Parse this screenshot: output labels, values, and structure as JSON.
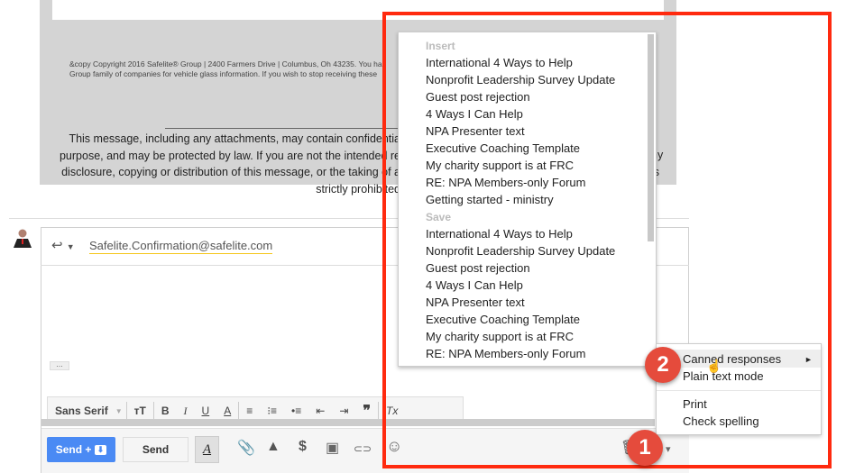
{
  "message": {
    "copyright_lines": [
      "&copy Copyright 2016 Safelite® Group | 2400 Farmers Drive | Columbus, Oh 43235. You ha",
      "Group family of companies for vehicle glass information. If you wish to stop receiving these"
    ],
    "disclaimer_lines": [
      "This message, including any attachments, may contain confidentia",
      "purpose, and may be protected by law. If you are not the intended re",
      "disclosure, copying or distribution of this message, or the taking of a",
      "strictly prohibited"
    ],
    "disclaimer_right": [
      "ny",
      "is"
    ]
  },
  "compose": {
    "to": "Safelite.Confirmation@safelite.com",
    "reply_icon": "reply-icon",
    "font": "Sans Serif",
    "send_plus": "Send +",
    "send": "Send",
    "toolbar_glyphs": {
      "size": "тT",
      "bold": "B",
      "italic": "I",
      "underline": "U",
      "color": "A",
      "quote": "❞",
      "clear": "Tx"
    },
    "bottom_glyphs": {
      "format": "A",
      "attach": "📎",
      "drive": "▲",
      "money": "$",
      "photo": "▣",
      "link": "⊂⊃",
      "emoji": "☺",
      "trash": "🗑",
      "more": "▾"
    }
  },
  "canned": {
    "insert_header": "Insert",
    "insert_items": [
      "International 4 Ways to Help",
      "Nonprofit Leadership Survey Update",
      "Guest post rejection",
      "4 Ways I Can Help",
      "NPA Presenter text",
      "Executive Coaching Template",
      "My charity support is at FRC",
      "RE: NPA Members-only Forum",
      "Getting started - ministry"
    ],
    "save_header": "Save",
    "save_items": [
      "International 4 Ways to Help",
      "Nonprofit Leadership Survey Update",
      "Guest post rejection",
      "4 Ways I Can Help",
      "NPA Presenter text",
      "Executive Coaching Template",
      "My charity support is at FRC",
      "RE: NPA Members-only Forum"
    ]
  },
  "more_menu": {
    "items": [
      "Canned responses",
      "Plain text mode",
      "Print",
      "Check spelling"
    ],
    "submenu_arrow": "►"
  },
  "annotations": {
    "badge1": "1",
    "badge2": "2",
    "highlight_color": "#ff2a0f",
    "badge_color": "#e54b3c"
  }
}
